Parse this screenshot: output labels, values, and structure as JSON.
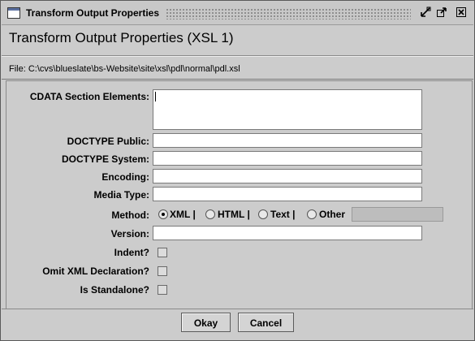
{
  "window": {
    "title": "Transform Output Properties",
    "buttons": {
      "minimize": "minimize-icon",
      "maximize": "maximize-icon",
      "close": "close-icon"
    }
  },
  "header": {
    "heading": "Transform Output Properties (XSL 1)",
    "file": "File: C:\\cvs\\blueslate\\bs-Website\\site\\xsl\\pdl\\normal\\pdl.xsl"
  },
  "form": {
    "cdata_label": "CDATA Section Elements:",
    "cdata_value": "",
    "doctype_public_label": "DOCTYPE Public:",
    "doctype_public_value": "",
    "doctype_system_label": "DOCTYPE System:",
    "doctype_system_value": "",
    "encoding_label": "Encoding:",
    "encoding_value": "",
    "media_type_label": "Media Type:",
    "media_type_value": "",
    "method_label": "Method:",
    "method_options": [
      {
        "label": "XML |",
        "selected": true
      },
      {
        "label": "HTML |",
        "selected": false
      },
      {
        "label": "Text |",
        "selected": false
      },
      {
        "label": "Other",
        "selected": false
      }
    ],
    "method_other_value": "",
    "version_label": "Version:",
    "version_value": "",
    "indent_label": "Indent?",
    "indent_checked": false,
    "omit_xml_label": "Omit XML Declaration?",
    "omit_xml_checked": false,
    "standalone_label": "Is Standalone?",
    "standalone_checked": false
  },
  "footer": {
    "okay_label": "Okay",
    "cancel_label": "Cancel"
  }
}
